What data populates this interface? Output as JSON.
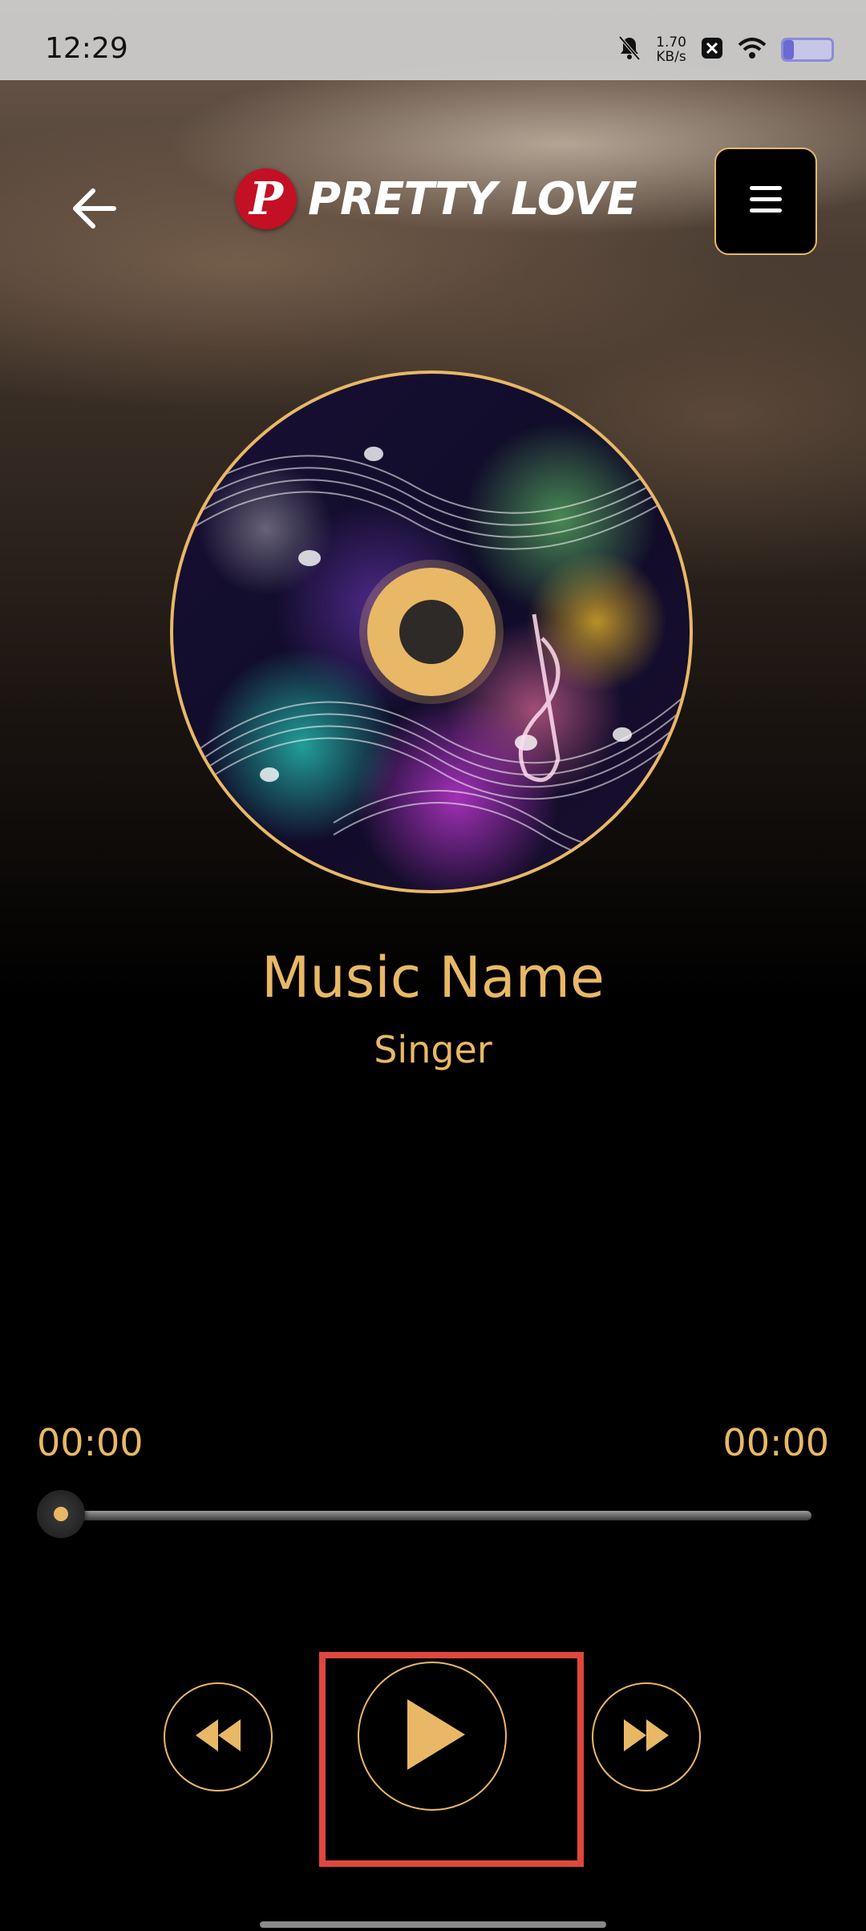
{
  "status_bar": {
    "time": "12:29",
    "speed_value": "1.70",
    "speed_unit": "KB/s",
    "battery_level": 0.22
  },
  "header": {
    "logo_letter": "P",
    "logo_text": "PRETTY LOVE",
    "back_icon": "arrow-left-icon",
    "menu_icon": "hamburger-menu-icon"
  },
  "track": {
    "title": "Music Name",
    "singer": "Singer"
  },
  "progress": {
    "current_time": "00:00",
    "total_time": "00:00",
    "value": 0
  },
  "controls": {
    "rewind_icon": "rewind-icon",
    "play_icon": "play-icon",
    "forward_icon": "fast-forward-icon"
  },
  "colors": {
    "accent": "#e9b866",
    "highlight": "#e0473e",
    "background": "#000000"
  }
}
